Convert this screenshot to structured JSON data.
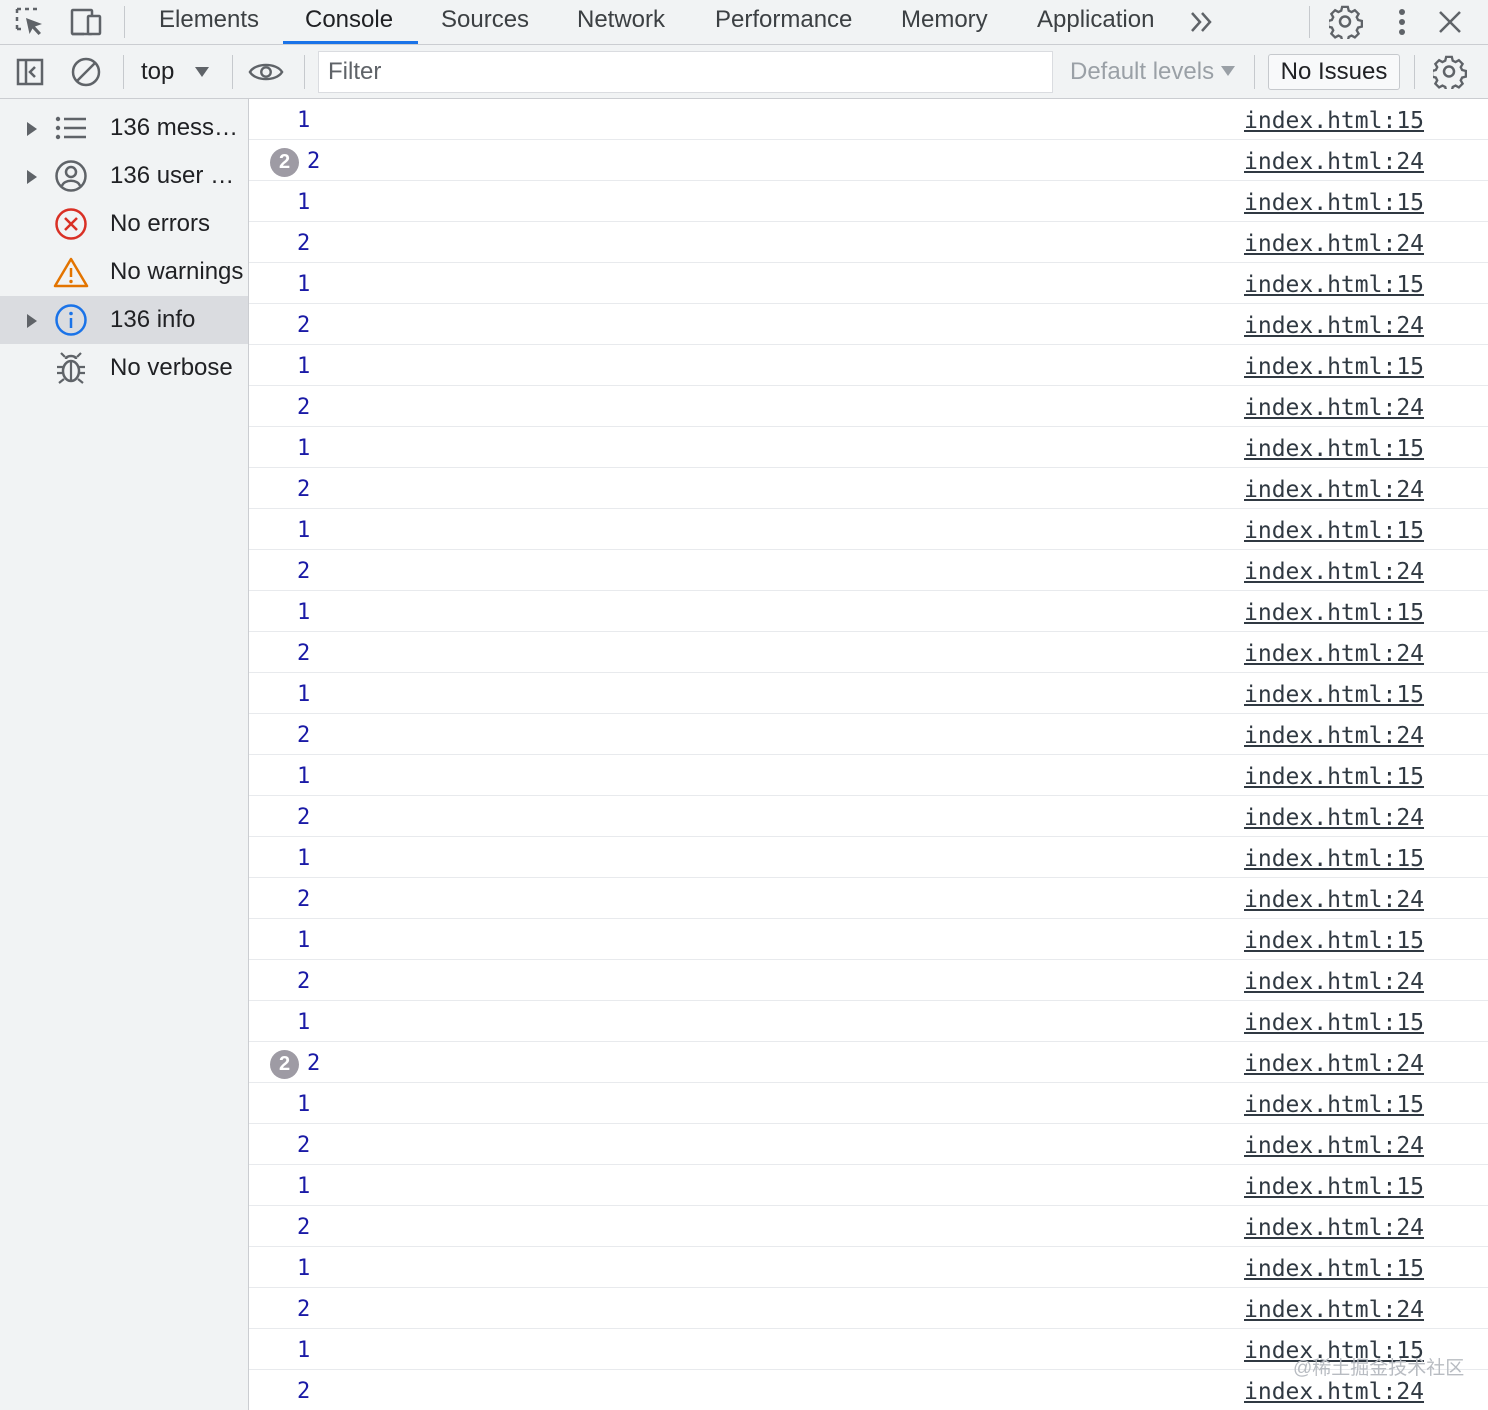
{
  "tabs": {
    "items": [
      {
        "label": "Elements"
      },
      {
        "label": "Console"
      },
      {
        "label": "Sources"
      },
      {
        "label": "Network"
      },
      {
        "label": "Performance"
      },
      {
        "label": "Memory"
      },
      {
        "label": "Application"
      }
    ],
    "active": "Console",
    "more_icon": "chevron-double-right-icon",
    "settings_icon": "gear-icon",
    "menu_icon": "kebab-menu-icon",
    "close_icon": "close-icon"
  },
  "toolbar": {
    "context": "top",
    "filter_placeholder": "Filter",
    "levels": "Default levels",
    "issues": "No Issues"
  },
  "sidebar": {
    "items": [
      {
        "label": "136 mess…",
        "icon": "list-icon",
        "expandable": true
      },
      {
        "label": "136 user …",
        "icon": "user-icon",
        "expandable": true
      },
      {
        "label": "No errors",
        "icon": "error-icon",
        "expandable": false
      },
      {
        "label": "No warnings",
        "icon": "warning-icon",
        "expandable": false
      },
      {
        "label": "136 info",
        "icon": "info-icon",
        "expandable": true,
        "selected": true
      },
      {
        "label": "No verbose",
        "icon": "bug-icon",
        "expandable": false
      }
    ]
  },
  "messages": [
    {
      "value": "1",
      "source": "index.html:15"
    },
    {
      "value": "2",
      "source": "index.html:24",
      "repeat": "2"
    },
    {
      "value": "1",
      "source": "index.html:15"
    },
    {
      "value": "2",
      "source": "index.html:24"
    },
    {
      "value": "1",
      "source": "index.html:15"
    },
    {
      "value": "2",
      "source": "index.html:24"
    },
    {
      "value": "1",
      "source": "index.html:15"
    },
    {
      "value": "2",
      "source": "index.html:24"
    },
    {
      "value": "1",
      "source": "index.html:15"
    },
    {
      "value": "2",
      "source": "index.html:24"
    },
    {
      "value": "1",
      "source": "index.html:15"
    },
    {
      "value": "2",
      "source": "index.html:24"
    },
    {
      "value": "1",
      "source": "index.html:15"
    },
    {
      "value": "2",
      "source": "index.html:24"
    },
    {
      "value": "1",
      "source": "index.html:15"
    },
    {
      "value": "2",
      "source": "index.html:24"
    },
    {
      "value": "1",
      "source": "index.html:15"
    },
    {
      "value": "2",
      "source": "index.html:24"
    },
    {
      "value": "1",
      "source": "index.html:15"
    },
    {
      "value": "2",
      "source": "index.html:24"
    },
    {
      "value": "1",
      "source": "index.html:15"
    },
    {
      "value": "2",
      "source": "index.html:24"
    },
    {
      "value": "1",
      "source": "index.html:15"
    },
    {
      "value": "2",
      "source": "index.html:24",
      "repeat": "2"
    },
    {
      "value": "1",
      "source": "index.html:15"
    },
    {
      "value": "2",
      "source": "index.html:24"
    },
    {
      "value": "1",
      "source": "index.html:15"
    },
    {
      "value": "2",
      "source": "index.html:24"
    },
    {
      "value": "1",
      "source": "index.html:15"
    },
    {
      "value": "2",
      "source": "index.html:24"
    },
    {
      "value": "1",
      "source": "index.html:15"
    },
    {
      "value": "2",
      "source": "index.html:24"
    }
  ],
  "watermark": "@稀土掘金技术社区",
  "colors": {
    "accent": "#1a73e8",
    "value_text": "#1a1aa6",
    "error": "#d93025",
    "warning": "#e37400",
    "info": "#1a73e8"
  }
}
